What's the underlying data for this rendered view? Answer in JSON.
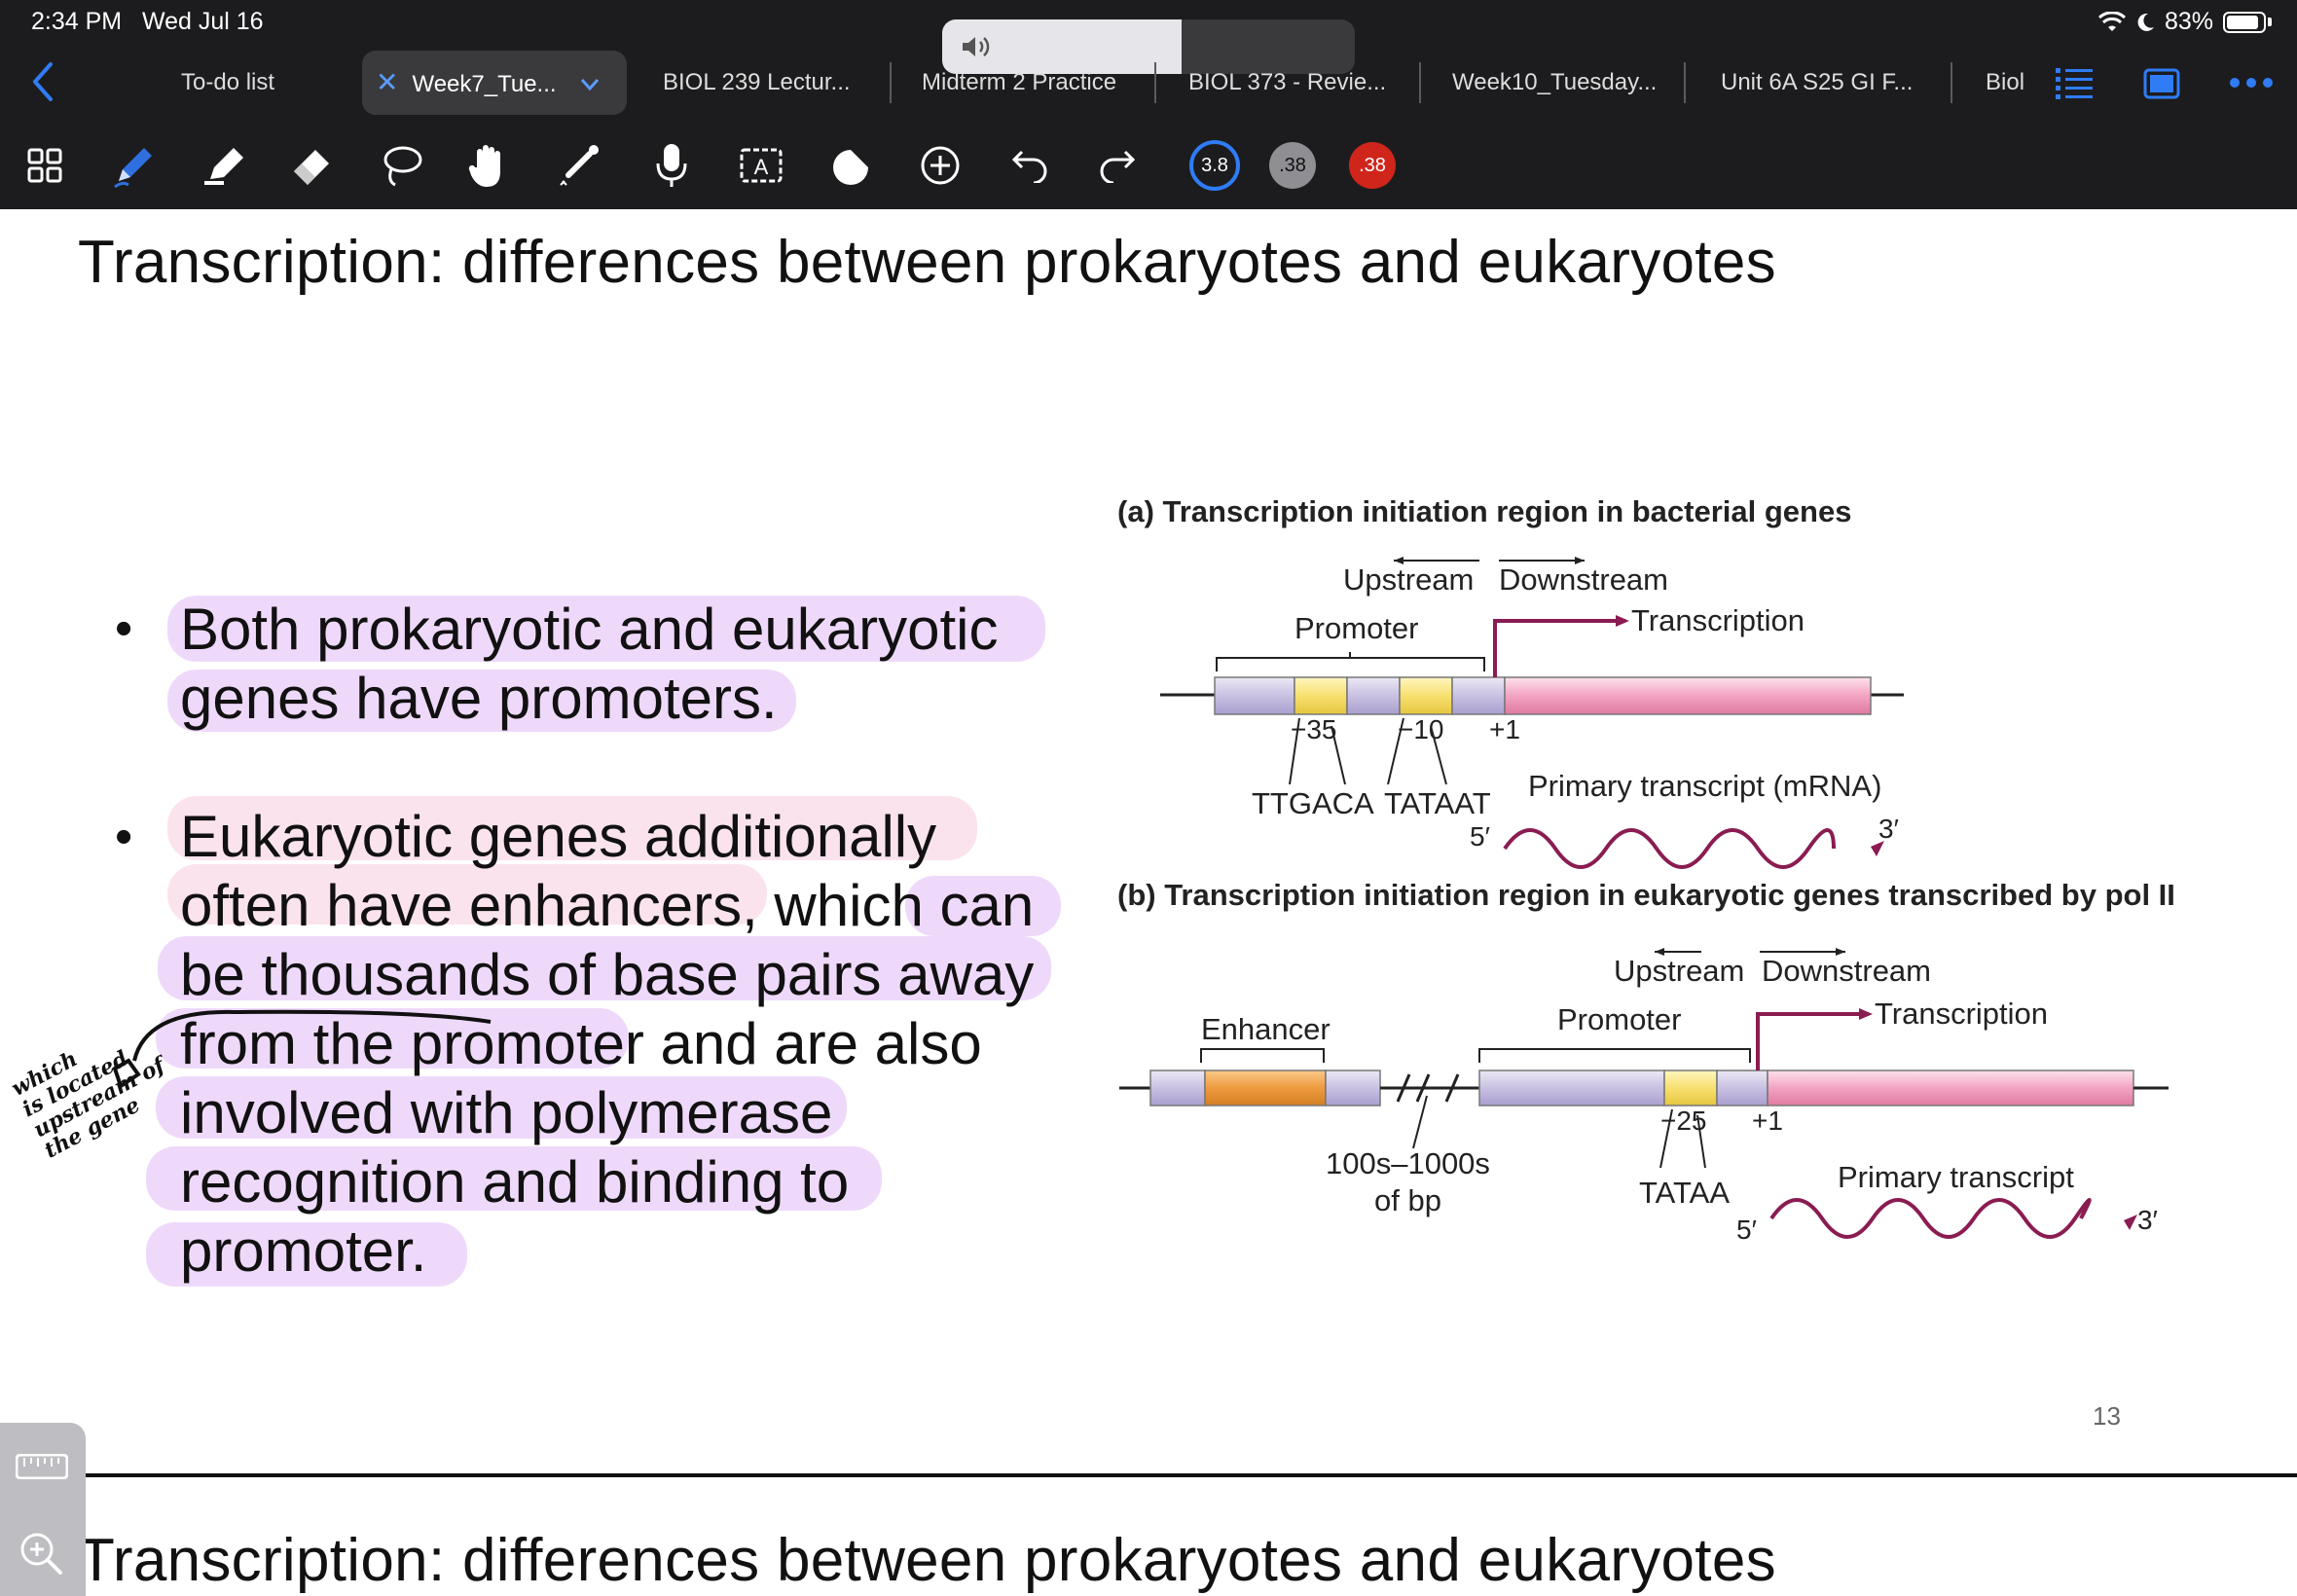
{
  "status_bar": {
    "time": "2:34 PM",
    "date": "Wed Jul 16",
    "battery": "83%",
    "volume_level": 0.58
  },
  "tabs": [
    {
      "label": "To-do list",
      "active": false
    },
    {
      "label": "Week7_Tue...",
      "active": true
    },
    {
      "label": "BIOL 239 Lectur...",
      "active": false
    },
    {
      "label": "Midterm 2 Practice",
      "active": false
    },
    {
      "label": "BIOL 373 - Revie...",
      "active": false
    },
    {
      "label": "Week10_Tuesday...",
      "active": false
    },
    {
      "label": "Unit 6A S25 GI F...",
      "active": false
    },
    {
      "label": "Biol",
      "active": false
    }
  ],
  "toolbar": {
    "tools": [
      "grid-icon",
      "pen-icon",
      "highlighter-icon",
      "eraser-icon",
      "lasso-icon",
      "hand-icon",
      "laser-icon",
      "microphone-icon",
      "textbox-icon",
      "shapes-icon",
      "add-icon",
      "undo-icon",
      "redo-icon"
    ],
    "swatches": [
      {
        "label": "3.8",
        "color": "#1c1c1e",
        "selected": true
      },
      {
        "label": ".38",
        "color": "#8e8e93",
        "selected": false
      },
      {
        "label": ".38",
        "color": "#d0251b",
        "selected": false
      }
    ]
  },
  "slide": {
    "title": "Transcription: differences between prokaryotes and eukaryotes",
    "bullet1": [
      "Both prokaryotic and eukaryotic",
      "genes have promoters."
    ],
    "bullet2": [
      "Eukaryotic genes additionally",
      "often have enhancers, which can",
      "be thousands of base pairs away",
      "from the promoter and are also",
      "involved with polymerase",
      "recognition and binding to",
      "promoter."
    ],
    "handwritten_note": [
      "which",
      "is located",
      "upstream of",
      "the gene"
    ],
    "page_number": "13",
    "next_title": "Transcription: differences between prokaryotes and eukaryotes"
  },
  "figure": {
    "a": {
      "title": "(a)  Transcription initiation region in bacterial genes",
      "upstream": "Upstream",
      "downstream": "Downstream",
      "promoter": "Promoter",
      "transcription": "Transcription",
      "m35": "−35",
      "m10": "−10",
      "p1": "+1",
      "seq35": "TTGACA",
      "seq10": "TATAAT",
      "transcript": "Primary transcript (mRNA)",
      "five": "5′",
      "three": "3′"
    },
    "b": {
      "title": "(b)  Transcription initiation region in eukaryotic genes transcribed by pol II",
      "upstream": "Upstream",
      "downstream": "Downstream",
      "enhancer": "Enhancer",
      "promoter": "Promoter",
      "transcription": "Transcription",
      "distance1": "100s–1000s",
      "distance2": "of bp",
      "m25": "−25",
      "p1": "+1",
      "seq25": "TATAA",
      "transcript": "Primary transcript",
      "five": "5′",
      "three": "3′"
    },
    "colors": {
      "lavender": "#cfc8e6",
      "yellow": "#f6e27a",
      "pink": "#f2a6c4",
      "orange": "#ee9a3e",
      "arrow": "#8a1c52"
    }
  }
}
